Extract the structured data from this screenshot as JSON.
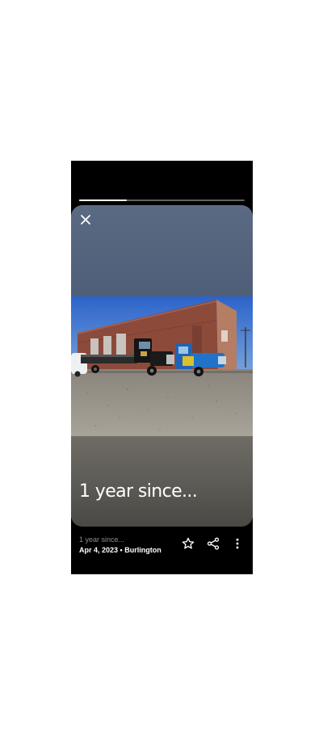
{
  "story": {
    "progress_fraction": 0.29,
    "title": "1 year since...",
    "subtitle": "1 year since...",
    "date": "Apr 4, 2023",
    "separator": "•",
    "location": "Burlington"
  },
  "icons": {
    "close": "close-icon",
    "favorite": "star-outline-icon",
    "share": "share-icon",
    "more": "more-vertical-icon"
  },
  "colors": {
    "background": "#000000",
    "text": "#ffffff",
    "subtext": "#8c8c8c",
    "truck_blue": "#1f63b8",
    "building_brick": "#8c4a3b"
  }
}
